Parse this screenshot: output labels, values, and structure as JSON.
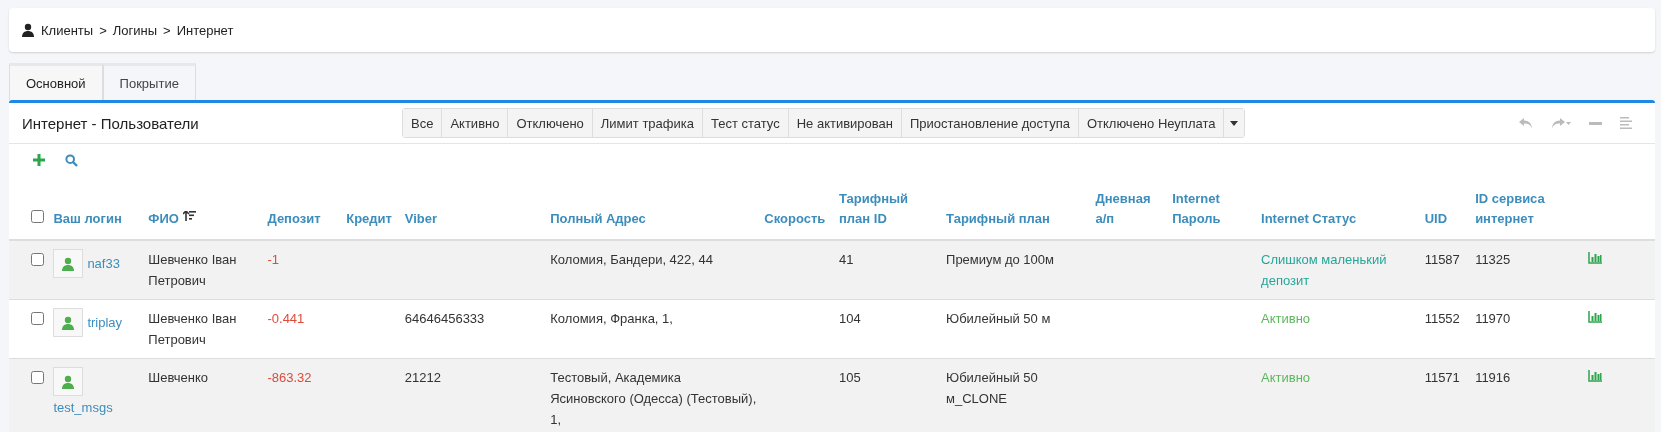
{
  "breadcrumb": [
    "Клиенты",
    "Логины",
    "Интернет"
  ],
  "breadcrumb_separator": ">",
  "tabs": [
    {
      "label": "Основной",
      "selected": true
    },
    {
      "label": "Покрытие",
      "selected": false
    }
  ],
  "panel": {
    "title": "Интернет - Пользователи",
    "filters": [
      "Все",
      "Активно",
      "Отключено",
      "Лимит трафика",
      "Тест статус",
      "Не активирован",
      "Приостановление доступа",
      "Отключено Неуплата"
    ]
  },
  "table": {
    "select_all_checked": false,
    "columns": [
      {
        "label": "Ваш логин"
      },
      {
        "label": "ФИО",
        "sorted": true
      },
      {
        "label": "Депозит"
      },
      {
        "label": "Кредит"
      },
      {
        "label": "Viber"
      },
      {
        "label": "Полный Адрес"
      },
      {
        "label": "Скорость"
      },
      {
        "label": "Тарифный план ID"
      },
      {
        "label": "Тарифный план"
      },
      {
        "label": "Дневная а/п"
      },
      {
        "label": "Internet Пароль"
      },
      {
        "label": "Internet Статус"
      },
      {
        "label": "UID"
      },
      {
        "label": "ID сервиса интернет"
      }
    ],
    "rows": [
      {
        "checked": false,
        "login": "naf33",
        "name": "Шевченко Іван Петрович",
        "deposit": "-1",
        "credit": "",
        "viber": "",
        "address": "Коломия, Бандери, 422, 44",
        "speed": "",
        "plan_id": "41",
        "plan": "Премиум до 100м",
        "daily": "",
        "password": "",
        "status": {
          "text": "Слишком маленький депозит",
          "color": "#26a69a"
        },
        "uid": "11587",
        "service_id": "11325"
      },
      {
        "checked": false,
        "login": "triplay",
        "name": "Шевченко Іван Петрович",
        "deposit": "-0.441",
        "credit": "",
        "viber": "64646456333",
        "address": "Коломия, Франка, 1,",
        "speed": "",
        "plan_id": "104",
        "plan": "Юбилейный 50 м",
        "daily": "",
        "password": "",
        "status": {
          "text": "Активно",
          "color": "#5cb85c"
        },
        "uid": "11552",
        "service_id": "11970"
      },
      {
        "checked": false,
        "login": "test_msgs",
        "name": "Шевченко",
        "deposit": "-863.32",
        "credit": "",
        "viber": "21212",
        "address": "Тестовый, Академика Ясиновского (Одесса) (Тестовый), 1,",
        "speed": "",
        "plan_id": "105",
        "plan": "Юбилейный 50 м_CLONE",
        "daily": "",
        "password": "",
        "status": {
          "text": "Активно",
          "color": "#5cb85c"
        },
        "uid": "11571",
        "service_id": "11916"
      }
    ]
  }
}
